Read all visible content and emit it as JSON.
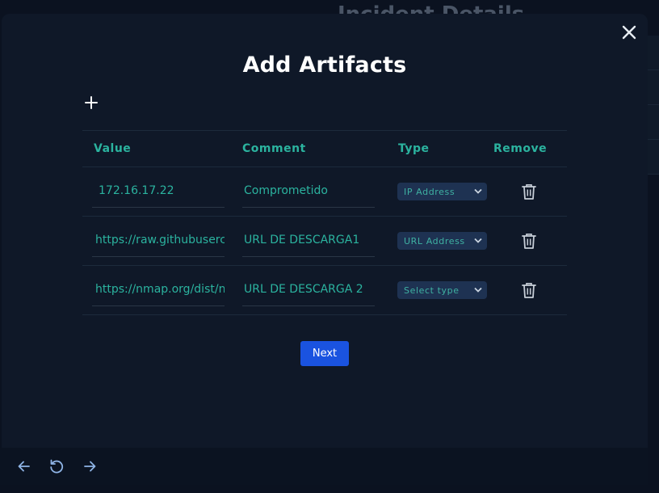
{
  "background": {
    "title": "Incident Details"
  },
  "modal": {
    "title": "Add Artifacts",
    "close_icon": "close-icon",
    "add_icon": "plus-icon",
    "next_label": "Next"
  },
  "table": {
    "headers": {
      "value": "Value",
      "comment": "Comment",
      "type": "Type",
      "remove": "Remove"
    },
    "rows": [
      {
        "value": "172.16.17.22",
        "comment": "Comprometido",
        "type": "IP Address"
      },
      {
        "value": "https://raw.githubuserc",
        "comment": "URL DE DESCARGA1",
        "type": "URL Address"
      },
      {
        "value": "https://nmap.org/dist/n",
        "comment": "URL DE DESCARGA 2",
        "type": "Select type"
      }
    ]
  },
  "navbar": {
    "icons": [
      "arrow-left-icon",
      "refresh-icon",
      "arrow-right-icon"
    ]
  },
  "colors": {
    "accent": "#2bb39f",
    "primary_button": "#1a53e0",
    "modal_bg": "#0f1828"
  }
}
